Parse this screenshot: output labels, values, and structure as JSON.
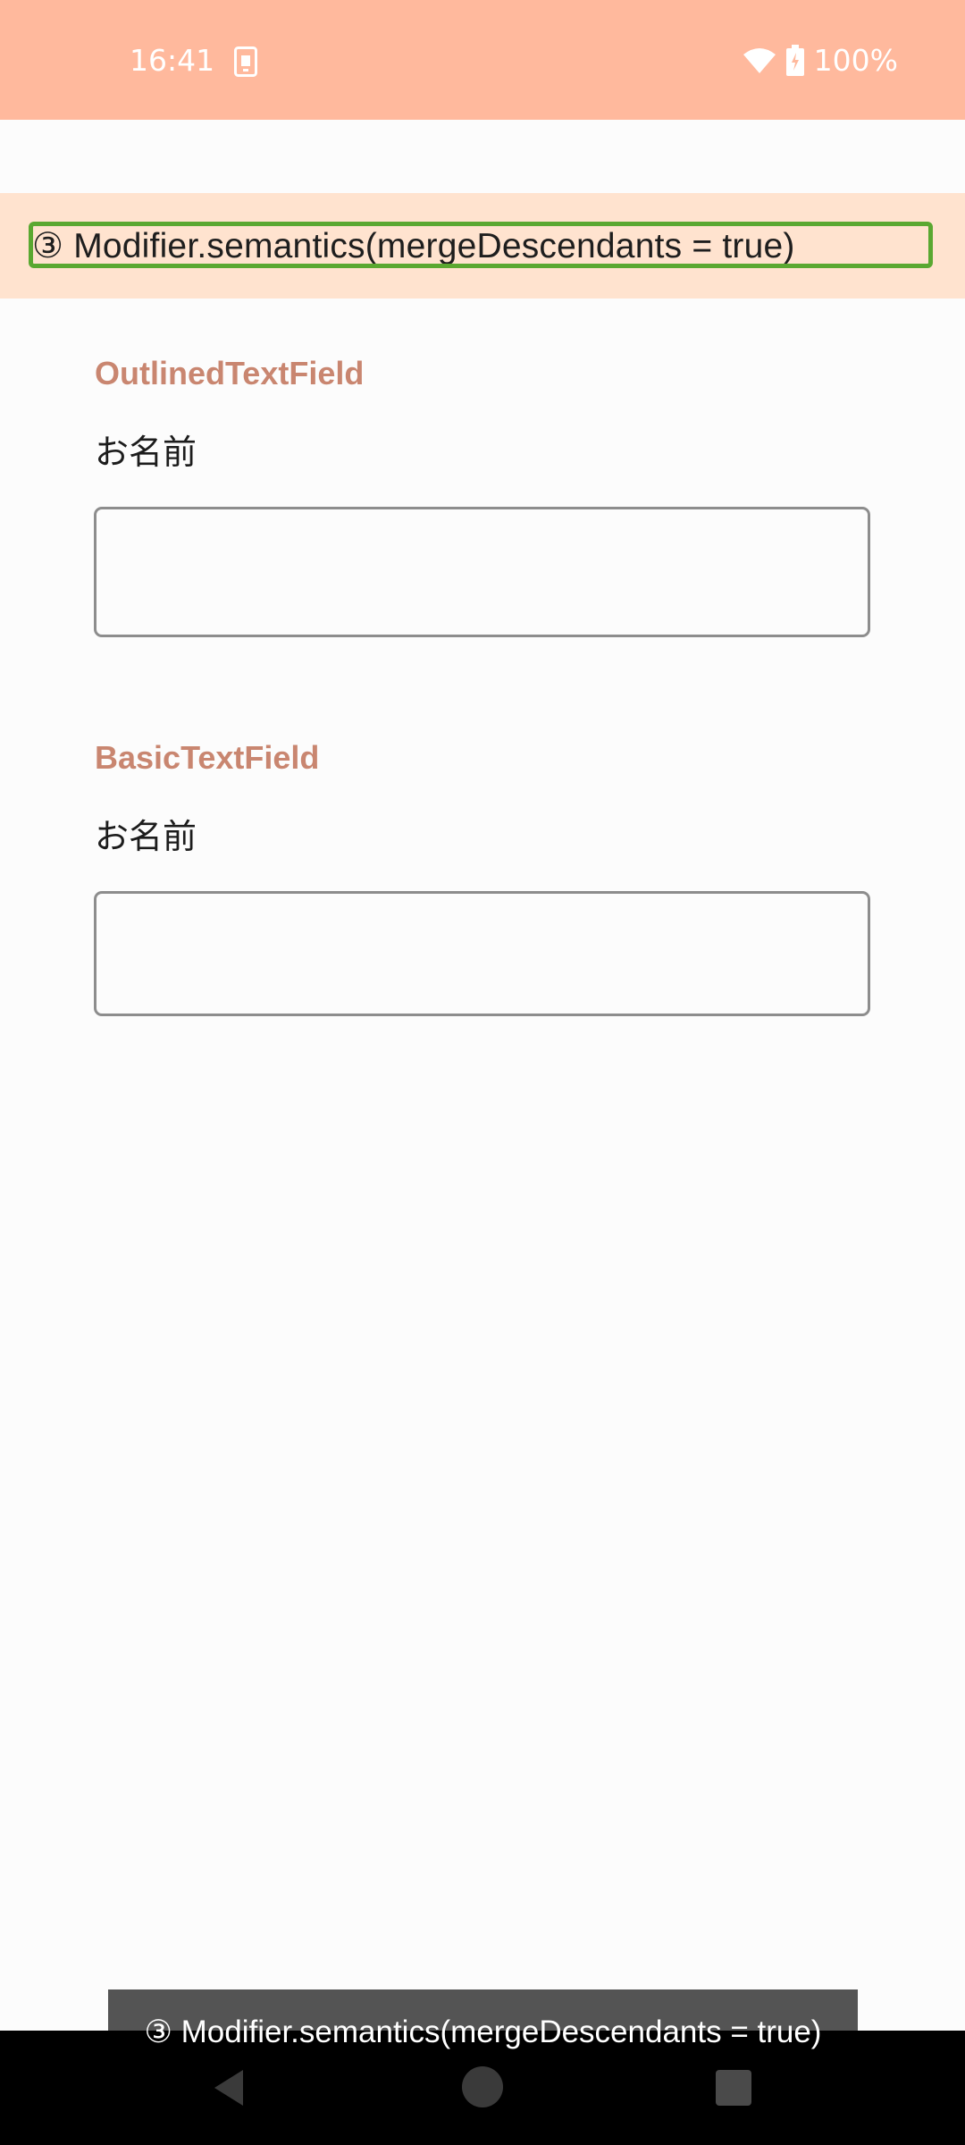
{
  "status_bar": {
    "time": "16:41",
    "battery": "100%",
    "background_color": "#ffb99d",
    "icons": [
      "app-notification-icon",
      "wifi-icon",
      "battery-icon"
    ]
  },
  "screen_title": "③ Modifier.semantics(mergeDescendants = true)",
  "sections": [
    {
      "heading": "OutlinedTextField",
      "label": "お名前",
      "value": ""
    },
    {
      "heading": "BasicTextField",
      "label": "お名前",
      "value": ""
    }
  ],
  "accessibility_caption": "③ Modifier.semantics(mergeDescendants = true)",
  "nav_bar": {
    "icons": [
      "back-icon",
      "home-icon",
      "recents-icon"
    ]
  },
  "colors": {
    "heading": "#c98670",
    "title_band": "#ffe3cf",
    "focus_outline": "#5aa831"
  }
}
